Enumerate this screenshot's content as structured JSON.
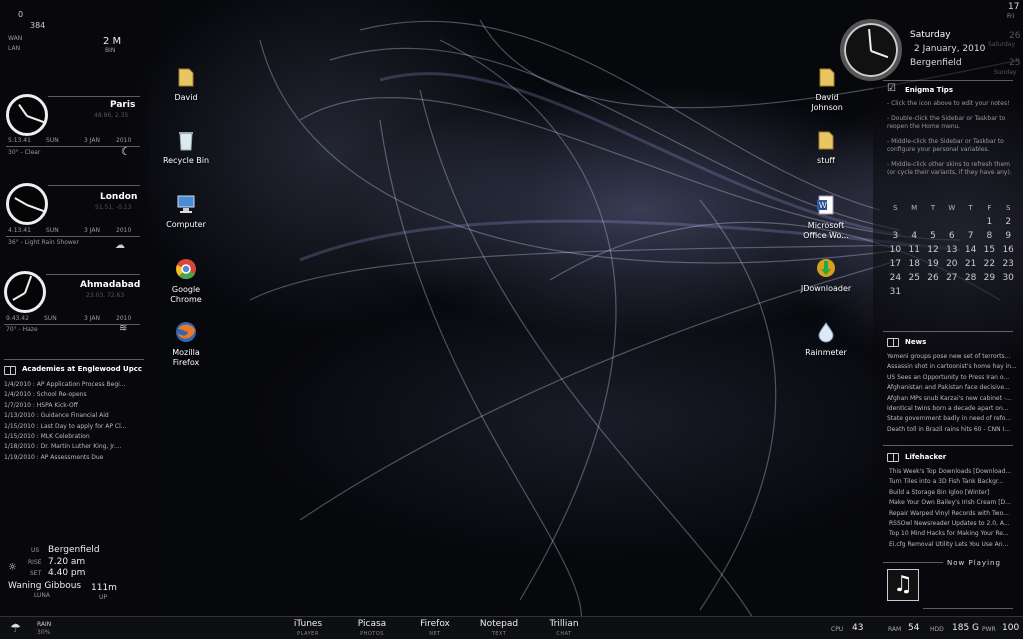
{
  "net": {
    "up_value": "0",
    "down_value": "384",
    "wan_label": "WAN",
    "lan_label": "LAN",
    "speed": "2 M",
    "speed_unit": "BIN"
  },
  "world_clocks": [
    {
      "city": "Paris",
      "coords": "48.86, 2.35",
      "time": "5.13.41",
      "day": "SUN",
      "date": "3 JAN",
      "year": "2010",
      "weather": "30° - Clear"
    },
    {
      "city": "London",
      "coords": "51.51, -0.13",
      "time": "4.13.41",
      "day": "SUN",
      "date": "3 JAN",
      "year": "2010",
      "weather": "36° - Light Rain Shower"
    },
    {
      "city": "Ahmadabad",
      "coords": "23.03, 72.63",
      "time": "9.43.42",
      "day": "SUN",
      "date": "3 JAN",
      "year": "2010",
      "weather": "70° - Haze"
    }
  ],
  "academies": {
    "title": "Academies at Englewood Upcc",
    "items": [
      "1/4/2010 : AP Application Process Begi...",
      "1/4/2010 : School Re-opens",
      "1/7/2010 : HSPA Kick-Off",
      "1/13/2010 : Guidance Financial Aid",
      "1/15/2010 : Last Day to apply for AP Cl...",
      "1/15/2010 : MLK Celebration",
      "1/18/2010 : Dr. Martin Luther King, Jr....",
      "1/19/2010 : AP Assessments Due"
    ]
  },
  "moon": {
    "city_prefix": "US",
    "city": "Bergenfield",
    "rise_label": "RISE",
    "rise": "7.20 am",
    "set_label": "SET",
    "set": "4.40 pm",
    "phase": "Waning Gibbous",
    "phase_label": "LUNA",
    "distance": "111m",
    "distance_label": "UP"
  },
  "desktop_icons_left": [
    "David",
    "Recycle Bin",
    "Computer",
    "Google Chrome",
    "Mozilla Firefox"
  ],
  "desktop_icons_right": [
    "David Johnson",
    "stuff",
    "Microsoft Office Wo...",
    "JDownloader",
    "Rainmeter"
  ],
  "date_widget": {
    "day": "Saturday",
    "date": "2 January, 2010",
    "location": "Bergenfield"
  },
  "edge_dates": [
    {
      "num": "17",
      "label": "Fri"
    },
    {
      "num": "26",
      "label": "Saturday"
    },
    {
      "num": "25",
      "label": "Sunday"
    }
  ],
  "tips": {
    "title": "Enigma Tips",
    "items": [
      "- Click the icon above to edit your notes!",
      "- Double-click the Sidebar or Taskbar to reopen the Home menu.",
      "- Middle-click the Sidebar or Taskbar to configure your personal variables.",
      "- Middle-click other skins to refresh them (or cycle their variants, if they have any)."
    ]
  },
  "calendar": {
    "headers": [
      "S",
      "M",
      "T",
      "W",
      "T",
      "F",
      "S"
    ],
    "weeks": [
      [
        "",
        "",
        "",
        "",
        "",
        "1",
        "2"
      ],
      [
        "3",
        "4",
        "5",
        "6",
        "7",
        "8",
        "9"
      ],
      [
        "10",
        "11",
        "12",
        "13",
        "14",
        "15",
        "16"
      ],
      [
        "17",
        "18",
        "19",
        "20",
        "21",
        "22",
        "23"
      ],
      [
        "24",
        "25",
        "26",
        "27",
        "28",
        "29",
        "30"
      ],
      [
        "31",
        "",
        "",
        "",
        "",
        "",
        ""
      ]
    ]
  },
  "news": {
    "title": "News",
    "items": [
      "Yemeni groups pose new set of terrorts...",
      "Assassin shot in cartoonist's home hay in...",
      "US Sees an Opportunity to Press Iran o...",
      "Afghanistan and Pakistan face decisive...",
      "Afghan MPs snub Karzai's new cabinet -...",
      "Identical twins born a decade apart on...",
      "State government badly in need of refo...",
      "Death toll in Brazil rains hits 60 - CNN I..."
    ]
  },
  "lifehacker": {
    "title": "Lifehacker",
    "items": [
      "This Week's Top Downloads [Download...",
      "Turn Tiles into a 3D Fish Tank Backgr...",
      "Build a Storage Bin Igloo [Winter]",
      "Make Your Own Bailey's Irish Cream [D...",
      "Repair Warped Vinyl Records with Two...",
      "RSSOwl Newsreader Updates to 2.0, A...",
      "Top 10 Mind Hacks for Making Your Re...",
      "Ei.cfg Removal Utility Lets You Use An..."
    ]
  },
  "now_playing": {
    "title": "Now Playing"
  },
  "taskbar": {
    "weather": {
      "label": "RAIN",
      "value": "30%"
    },
    "apps": [
      {
        "name": "iTunes",
        "sub": "PLAYER"
      },
      {
        "name": "Picasa",
        "sub": "PHOTOS"
      },
      {
        "name": "Firefox",
        "sub": "NET"
      },
      {
        "name": "Notepad",
        "sub": "TEXT"
      },
      {
        "name": "Trillian",
        "sub": "CHAT"
      }
    ],
    "stats": {
      "cpu_label": "CPU",
      "cpu": "43",
      "ram_label": "RAM",
      "ram": "54",
      "hdd_label": "HDD",
      "hdd": "185 G",
      "pwr_label": "PWR",
      "pwr": "100"
    }
  }
}
